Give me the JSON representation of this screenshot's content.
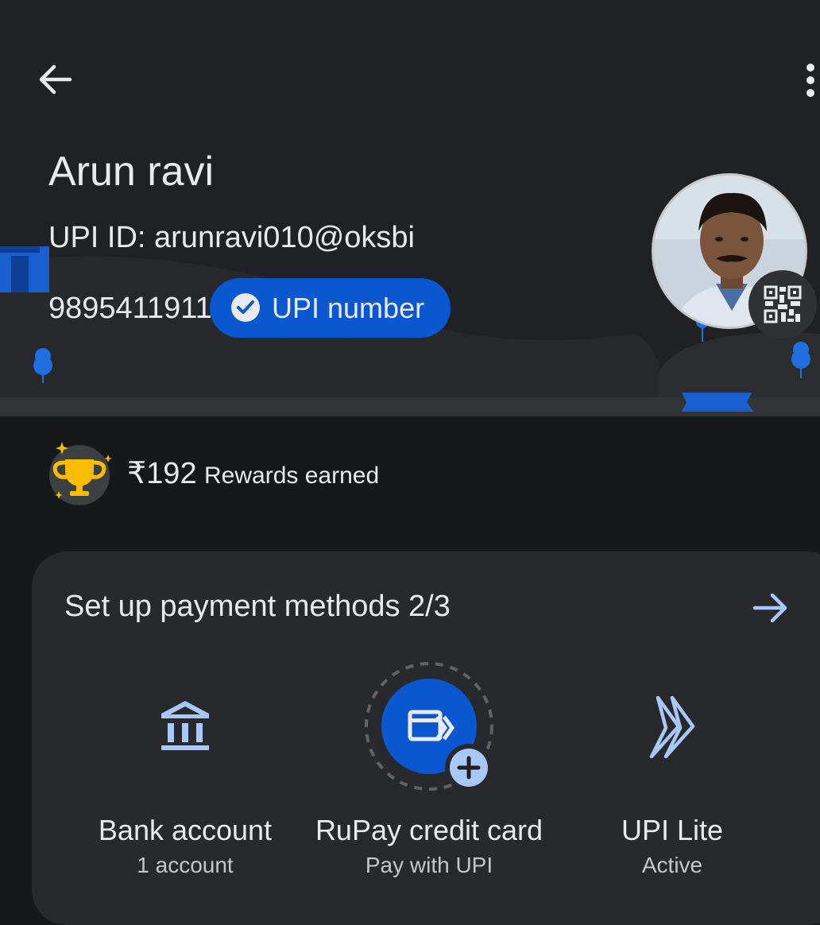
{
  "profile": {
    "name": "Arun ravi",
    "upi_id": "UPI ID: arunravi010@oksbi",
    "phone": "9895411911",
    "upi_chip_label": "UPI number"
  },
  "rewards": {
    "amount": "₹192",
    "label": "Rewards earned"
  },
  "payment_setup": {
    "title": "Set up payment methods 2/3",
    "methods": [
      {
        "title": "Bank account",
        "subtitle": "1 account",
        "icon": "bank-icon"
      },
      {
        "title": "RuPay credit card",
        "subtitle": "Pay with UPI",
        "icon": "credit-card-icon"
      },
      {
        "title": "UPI Lite",
        "subtitle": "Active",
        "icon": "upi-lite-icon"
      }
    ]
  },
  "colors": {
    "background": "#17181a",
    "header_bg": "#202124",
    "card_bg": "#28292c",
    "accent_blue": "#0b57d0",
    "icon_blue": "#a8c7fa",
    "text": "#e8eaed"
  }
}
